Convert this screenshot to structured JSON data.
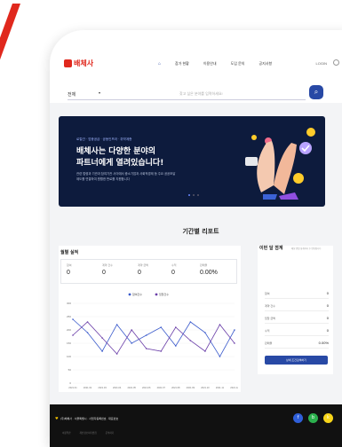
{
  "brand": {
    "name": "배체사",
    "color": "#e0281d"
  },
  "nav": {
    "home_icon": "home-icon",
    "items": [
      "참가 현황",
      "이용안내",
      "도입 문의",
      "공지사항"
    ],
    "login_label": "LOGIN"
  },
  "search": {
    "select_value": "전체",
    "placeholder": "찾고 싶은 분야를 입력하세요!"
  },
  "banner": {
    "small": "로컬관 · 업종공급 · 공동인프라 · 취약계층",
    "title_line1": "배체사는 다양한 분야의",
    "title_line2": "파트너에게 열려있습니다!",
    "desc_line1": "관련 법령과 기관과 참여기관 사이에서 중소기업과 사회적경제 등 주요 공공조달",
    "desc_line2": "제도를 연결하여 원활한 판로를 지원합니다",
    "dots": 3,
    "active_dot": 1
  },
  "report": {
    "title": "기간별 리포트",
    "left_title": "월별 실적",
    "stats": [
      {
        "label": "참여",
        "value": "0"
      },
      {
        "label": "계약 건수",
        "value": "0"
      },
      {
        "label": "계약 금액",
        "value": "0"
      },
      {
        "label": "수익",
        "value": "0"
      },
      {
        "label": "판매율",
        "value": "0.00%"
      }
    ],
    "right_title": "이번 달 점계",
    "right_note": "매달 말일 회계처리 후 반영됩니다",
    "right_rows": [
      {
        "label": "참여",
        "value": "0"
      },
      {
        "label": "계약 건수",
        "value": "0"
      },
      {
        "label": "입찰 금액",
        "value": "0"
      },
      {
        "label": "수익",
        "value": "0"
      },
      {
        "label": "판매율",
        "value": "0.00%"
      }
    ],
    "detail_button": "상세 조건검색하기"
  },
  "chart_data": {
    "type": "line",
    "x": [
      "2021.01",
      "2021.02",
      "2021.03",
      "2021.04",
      "2021.05",
      "2021.06",
      "2021.07",
      "2021.08",
      "2021.09",
      "2021.10",
      "2021.11",
      "2021.12"
    ],
    "series": [
      {
        "name": "참여건수",
        "color": "#3b5bcc",
        "values": [
          240,
          190,
          120,
          220,
          150,
          180,
          210,
          140,
          230,
          190,
          100,
          200
        ]
      },
      {
        "name": "입찰건수",
        "color": "#6a3ea8",
        "values": [
          180,
          230,
          170,
          110,
          200,
          130,
          120,
          210,
          160,
          120,
          220,
          150
        ]
      }
    ],
    "ylim": [
      0,
      300
    ],
    "yticks": [
      0,
      50,
      100,
      150,
      200,
      250,
      300
    ],
    "legend": "top-center",
    "grid": true
  },
  "footer": {
    "text": "(주)배체사 · 서울특별시 · 사업자등록번호 · 대표번호",
    "links": [
      "이용약관",
      "개인정보처리방침",
      "문의하기"
    ],
    "social": [
      {
        "icon": "facebook-icon",
        "glyph": "f",
        "color": "#2f5fd9"
      },
      {
        "icon": "blog-icon",
        "glyph": "b",
        "color": "#2bb04d"
      },
      {
        "icon": "kakao-icon",
        "glyph": "k",
        "color": "#f7d51a"
      }
    ]
  }
}
